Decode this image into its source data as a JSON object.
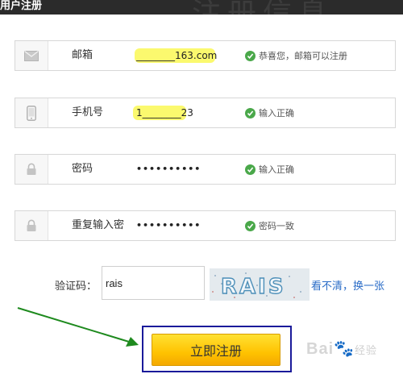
{
  "header": {
    "title": "用户注册",
    "watermark_text": "注册信息"
  },
  "fields": [
    {
      "icon": "envelope-icon",
      "label": "邮箱",
      "value": "________163.com",
      "status": "恭喜您，邮箱可以注册"
    },
    {
      "icon": "mobile-phone-icon",
      "label": "手机号",
      "value": "1________23",
      "status": "输入正确"
    },
    {
      "icon": "lock-icon",
      "label": "密码",
      "value": "••••••••••",
      "status": "输入正确"
    },
    {
      "icon": "lock-icon",
      "label": "重复输入密",
      "value": "••••••••••",
      "status": "密码一致"
    }
  ],
  "captcha": {
    "label": "验证码：",
    "input_value": "rais",
    "image_text": "RAIS",
    "refresh_link": "看不清，换一张"
  },
  "register_button": {
    "label": "立即注册"
  },
  "watermark": {
    "brand": "Bai",
    "suffix": "经验"
  },
  "colors": {
    "accent": "#ffc200",
    "status_ok": "#4aa84a",
    "link": "#2a6cc7",
    "frame": "#1a1a9a",
    "arrow": "#1e8a1e"
  }
}
